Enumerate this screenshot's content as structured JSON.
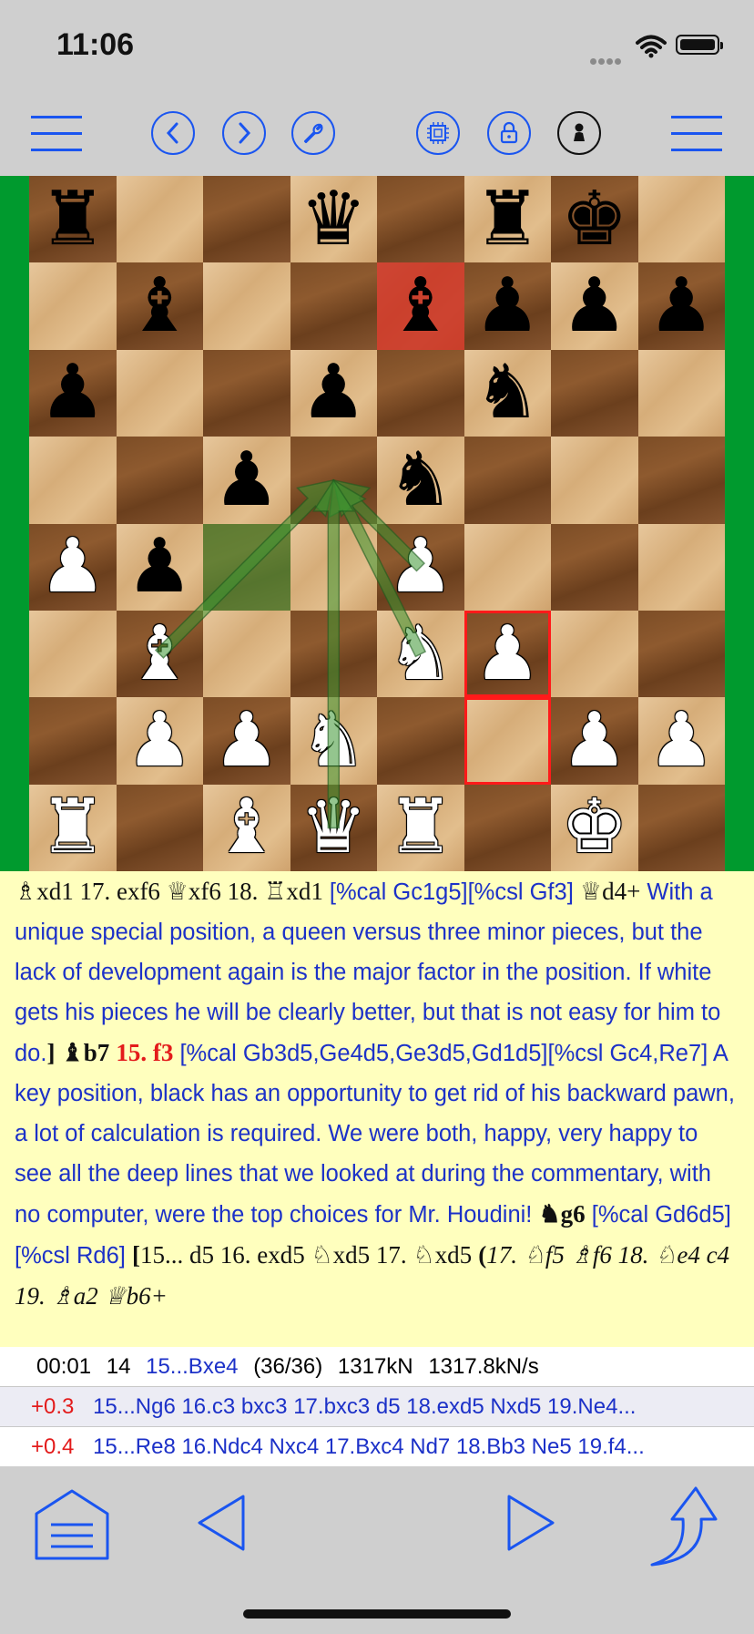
{
  "status_bar": {
    "time": "11:06"
  },
  "toolbar": {
    "items": [
      {
        "name": "left-menu",
        "icon": "hamburger-icon"
      },
      {
        "name": "back",
        "icon": "chevron-left-icon"
      },
      {
        "name": "forward",
        "icon": "chevron-right-icon"
      },
      {
        "name": "tools",
        "icon": "wrench-icon"
      },
      {
        "name": "engine",
        "icon": "cpu-chip-icon"
      },
      {
        "name": "lock",
        "icon": "lock-icon"
      },
      {
        "name": "side-to-move",
        "icon": "pawn-icon"
      },
      {
        "name": "right-menu",
        "icon": "hamburger-icon"
      }
    ],
    "accent": "#1a55f0"
  },
  "board": {
    "colors": {
      "frame": "#009a2e",
      "highlight_red": "#c8281c"
    },
    "highlights": [
      {
        "square": "e7",
        "type": "red-fill"
      },
      {
        "square": "f3",
        "type": "red-outline"
      },
      {
        "square": "f2",
        "type": "red-outline"
      },
      {
        "square": "c4",
        "type": "green-fill"
      }
    ],
    "pieces": [
      {
        "square": "a8",
        "glyph": "♜",
        "color": "b"
      },
      {
        "square": "d8",
        "glyph": "♛",
        "color": "b"
      },
      {
        "square": "f8",
        "glyph": "♜",
        "color": "b"
      },
      {
        "square": "g8",
        "glyph": "♚",
        "color": "b"
      },
      {
        "square": "b7",
        "glyph": "♝",
        "color": "b"
      },
      {
        "square": "e7",
        "glyph": "♝",
        "color": "b"
      },
      {
        "square": "f7",
        "glyph": "♟",
        "color": "b"
      },
      {
        "square": "g7",
        "glyph": "♟",
        "color": "b"
      },
      {
        "square": "h7",
        "glyph": "♟",
        "color": "b"
      },
      {
        "square": "a6",
        "glyph": "♟",
        "color": "b"
      },
      {
        "square": "d6",
        "glyph": "♟",
        "color": "b"
      },
      {
        "square": "f6",
        "glyph": "♞",
        "color": "b"
      },
      {
        "square": "c5",
        "glyph": "♟",
        "color": "b"
      },
      {
        "square": "e5",
        "glyph": "♞",
        "color": "b"
      },
      {
        "square": "b4",
        "glyph": "♟",
        "color": "b"
      },
      {
        "square": "a4",
        "glyph": "♟",
        "color": "w"
      },
      {
        "square": "e4",
        "glyph": "♟",
        "color": "w"
      },
      {
        "square": "b3",
        "glyph": "♝",
        "color": "w"
      },
      {
        "square": "e3",
        "glyph": "♞",
        "color": "w"
      },
      {
        "square": "f3",
        "glyph": "♟",
        "color": "w"
      },
      {
        "square": "b2",
        "glyph": "♟",
        "color": "w"
      },
      {
        "square": "c2",
        "glyph": "♟",
        "color": "w"
      },
      {
        "square": "d2",
        "glyph": "♞",
        "color": "w"
      },
      {
        "square": "g2",
        "glyph": "♟",
        "color": "w"
      },
      {
        "square": "h2",
        "glyph": "♟",
        "color": "w"
      },
      {
        "square": "a1",
        "glyph": "♜",
        "color": "w"
      },
      {
        "square": "c1",
        "glyph": "♝",
        "color": "w"
      },
      {
        "square": "d1",
        "glyph": "♛",
        "color": "w"
      },
      {
        "square": "e1",
        "glyph": "♜",
        "color": "w"
      },
      {
        "square": "g1",
        "glyph": "♚",
        "color": "w"
      }
    ],
    "arrows": [
      {
        "from": "b3",
        "to": "d5"
      },
      {
        "from": "e4",
        "to": "d5"
      },
      {
        "from": "e3",
        "to": "d5"
      },
      {
        "from": "d1",
        "to": "d5"
      }
    ]
  },
  "notes": {
    "line0_m1": "♗xd1 17. exf6 ♕xf6 18. ♖xd1",
    "line0_c1": " [%cal Gc1g5][%csl Gf3] ",
    "line0_m2": "♕d4+",
    "comment1": "With a unique special position, a queen versus three minor pieces, but the lack of development again is the major factor in the position. If white gets his pieces he will be clearly better, but that is not easy for him to do.",
    "bracket_close": "]",
    "move_bb7": "♝b7",
    "move_15f3": "15. f3",
    "comment2": "[%cal Gb3d5,Ge4d5,Ge3d5,Gd1d5][%csl Gc4,Re7] A key position, black has an opportunity to get rid of his backward pawn, a lot of calculation is required. We were both, happy, very happy to see all the deep lines that we looked at during the commentary, with no computer, were the top choices for Mr. Houdini!",
    "move_ng6": "♞g6",
    "comment3": "[%cal Gd6d5][%csl Rd6]",
    "bracket_open": "[",
    "variation1": "15... d5 16. exd5 ♘xd5 17. ♘xd5",
    "paren_open": "(",
    "variation2": "17. ♘f5 ♗f6 18. ♘e4 c4 19. ♗a2 ♕b6+"
  },
  "engine": {
    "status": {
      "time": "00:01",
      "depth": "14",
      "current_move": "15...Bxe4",
      "moves": "(36/36)",
      "nodes": "1317kN",
      "speed": "1317.8kN/s"
    },
    "lines": [
      {
        "score": "+0.3",
        "pv": "15...Ng6 16.c3 bxc3 17.bxc3 d5 18.exd5 Nxd5 19.Ne4..."
      },
      {
        "score": "+0.4",
        "pv": "15...Re8 16.Ndc4 Nxc4 17.Bxc4 Nd7 18.Bb3 Ne5 19.f4..."
      }
    ]
  },
  "bottom_bar": {
    "items": [
      {
        "name": "home",
        "icon": "home-list-icon"
      },
      {
        "name": "previous",
        "icon": "triangle-left-icon"
      },
      {
        "name": "next",
        "icon": "triangle-right-icon"
      },
      {
        "name": "share",
        "icon": "share-arrow-icon"
      }
    ]
  }
}
